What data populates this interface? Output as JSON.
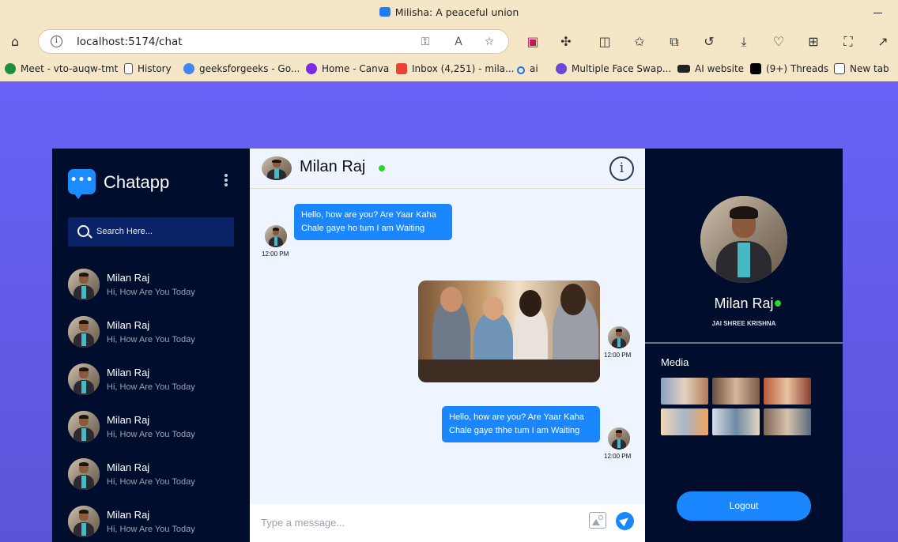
{
  "browser": {
    "window_title": "Milisha: A peaceful union",
    "url": "localhost:5174/chat",
    "bookmarks": [
      {
        "label": "Meet - vto-auqw-tmt",
        "color": "#1e8e3e"
      },
      {
        "label": "History",
        "color": "#ffffff"
      },
      {
        "label": "geeksforgeeks - Go...",
        "color": "#4285f4"
      },
      {
        "label": "Home - Canva",
        "color": "#7d2ae8"
      },
      {
        "label": "Inbox (4,251) - mila...",
        "color": "#ea4335"
      },
      {
        "label": "ai",
        "color": "#1a73e8"
      },
      {
        "label": "Multiple Face Swap...",
        "color": "#6b47dc"
      },
      {
        "label": "AI website",
        "color": "#222222"
      },
      {
        "label": "(9+) Threads",
        "color": "#000000"
      },
      {
        "label": "New tab",
        "color": "#444444"
      }
    ]
  },
  "sidebar": {
    "brand": "Chatapp",
    "search_placeholder": "Search Here...",
    "contacts": [
      {
        "name": "Milan Raj",
        "message": "Hi, How Are You Today"
      },
      {
        "name": "Milan Raj",
        "message": "Hi, How Are You Today"
      },
      {
        "name": "Milan Raj",
        "message": "Hi, How Are You Today"
      },
      {
        "name": "Milan Raj",
        "message": "Hi, How Are You Today"
      },
      {
        "name": "Milan Raj",
        "message": "Hi, How Are You Today"
      },
      {
        "name": "Milan Raj",
        "message": "Hi, How Are You Today"
      }
    ]
  },
  "chat": {
    "contact_name": "Milan Raj",
    "online": true,
    "messages": [
      {
        "type": "text",
        "direction": "incoming",
        "text": "Hello, how are you? Are Yaar Kaha Chale gaye ho tum I am Waiting",
        "time": "12:00 PM"
      },
      {
        "type": "image",
        "direction": "outgoing",
        "time": "12:00 PM"
      },
      {
        "type": "text",
        "direction": "outgoing",
        "text": "Hello, how are you? Are Yaar Kaha Chale gaye thhe tum I am Waiting",
        "time": "12:00 PM"
      }
    ],
    "composer_placeholder": "Type a message..."
  },
  "profile": {
    "name": "Milan Raj",
    "status": "JAI SHREE KRISHNA",
    "media_title": "Media",
    "media_count": 6,
    "logout_label": "Logout"
  },
  "colors": {
    "accent": "#1a87ff",
    "sidebar_bg": "#000d2d",
    "chat_bg": "#eff5ff",
    "page_gradient_top": "#6a62f6",
    "online": "#2bd62b"
  }
}
